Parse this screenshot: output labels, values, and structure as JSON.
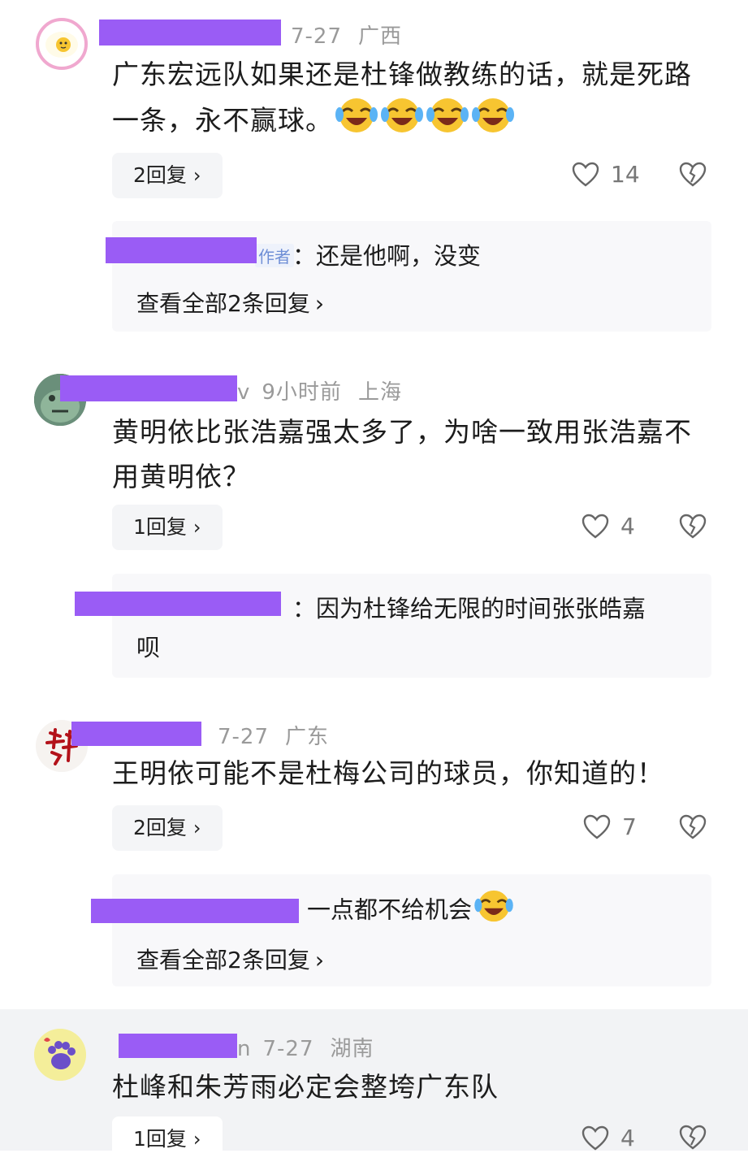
{
  "comments": [
    {
      "date": "7-27",
      "location": "广西",
      "text": "广东宏远队如果还是杜锋做教练的话，就是死路一条，永不赢球。",
      "reply_label": "2回复",
      "like_count": "14",
      "reply_preview": {
        "tag": "作者",
        "text": "：还是他啊，没变",
        "more": "查看全部2条回复"
      }
    },
    {
      "name_tail": "v",
      "date": "9小时前",
      "location": "上海",
      "text": "黄明依比张浩嘉强太多了，为啥一致用张浩嘉不用黄明依？",
      "reply_label": "1回复",
      "like_count": "4",
      "reply_preview": {
        "text_line1": "：因为杜锋给无限的时间张张皓嘉",
        "text_line2": "呗"
      }
    },
    {
      "date": "7-27",
      "location": "广东",
      "text": "王明依可能不是杜梅公司的球员，你知道的！",
      "reply_label": "2回复",
      "like_count": "7",
      "reply_preview": {
        "text": "一点都不给机会",
        "more": "查看全部2条回复"
      }
    },
    {
      "name_tail": "n",
      "date": "7-27",
      "location": "湖南",
      "text": "杜峰和朱芳雨必定会整垮广东队",
      "reply_label": "1回复",
      "like_count": "4"
    }
  ],
  "icons": {
    "like": "heart-outline-icon",
    "dislike": "broken-heart-icon",
    "chevron": "chevron-right-icon",
    "emoji": "laughing-crying-emoji-icon"
  },
  "colors": {
    "redaction": "#9a5cf5",
    "meta_text": "#9a9a9a"
  }
}
